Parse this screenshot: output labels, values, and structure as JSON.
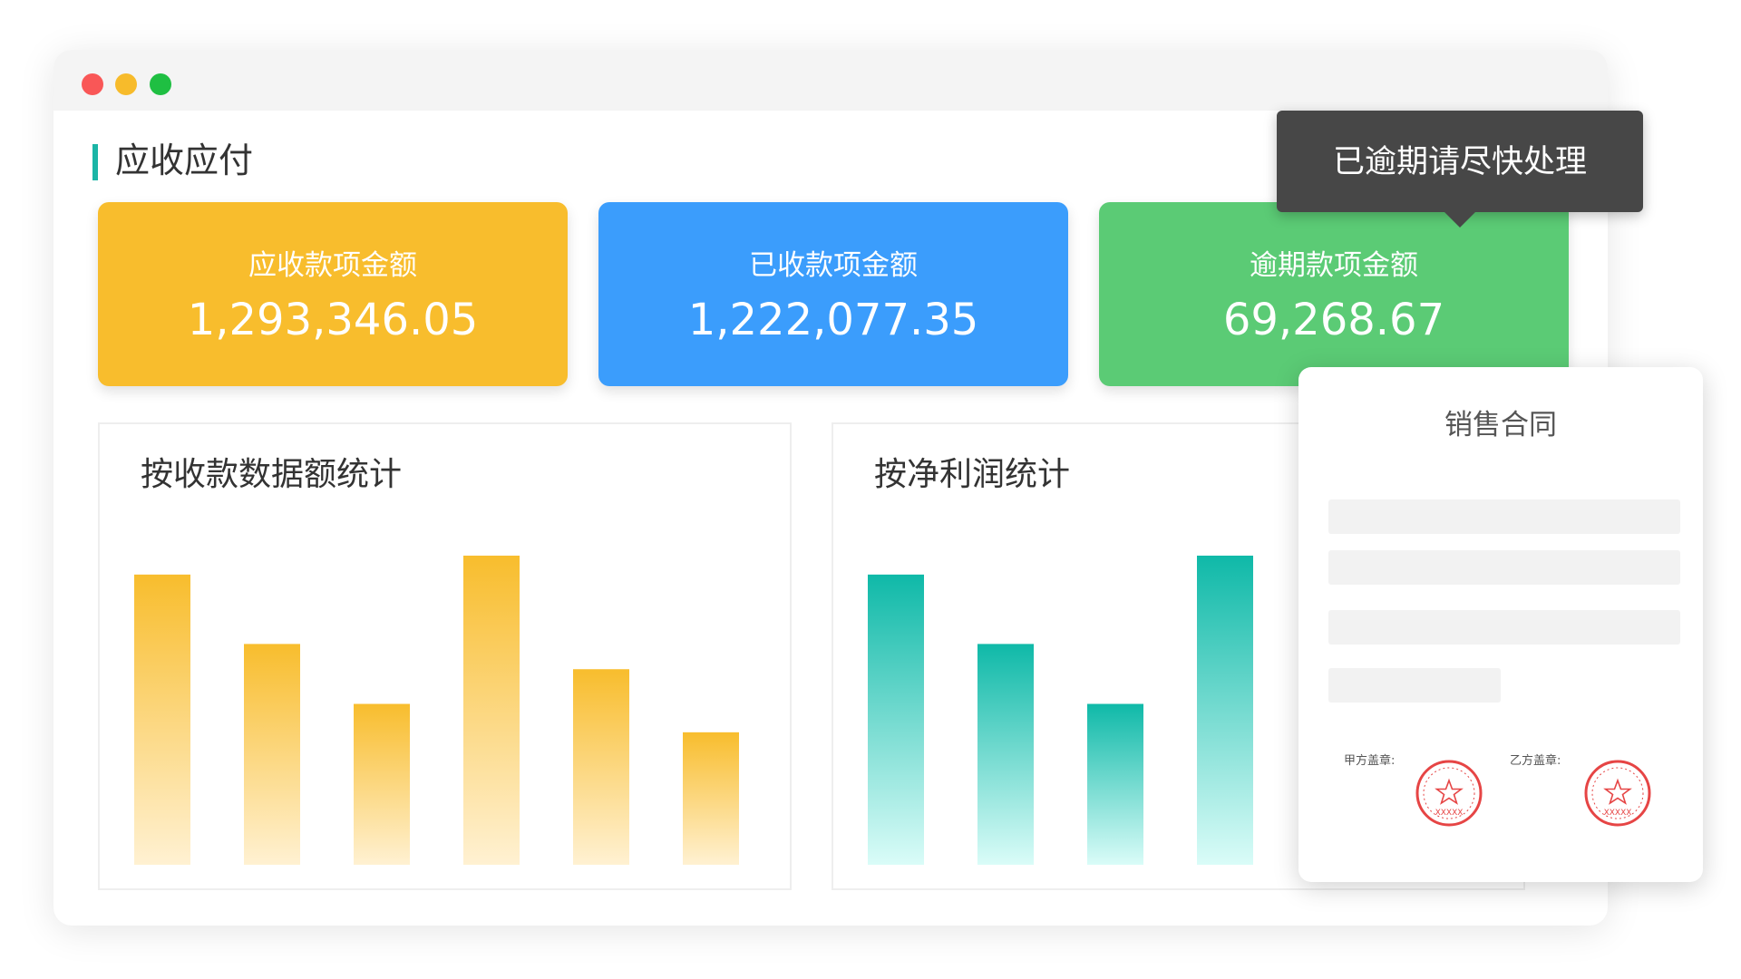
{
  "window": {
    "traffic_lights": [
      "close",
      "minimize",
      "maximize"
    ],
    "colors": {
      "close": "#f95757",
      "minimize": "#f7bb2b",
      "maximize": "#1fbf42"
    }
  },
  "section": {
    "title": "应收应付",
    "accent": "#1bb5a6"
  },
  "cards": [
    {
      "label": "应收款项金额",
      "value": "1,293,346.05",
      "color": "#f8bd2d"
    },
    {
      "label": "已收款项金额",
      "value": "1,222,077.35",
      "color": "#3b9dfc"
    },
    {
      "label": "逾期款项金额",
      "value": "69,268.67",
      "color": "#5bcb75"
    }
  ],
  "tooltip": {
    "text": "已逾期请尽快处理"
  },
  "chart_data": [
    {
      "type": "bar",
      "title": "按收款数据额统计",
      "categories": [],
      "values": [
        92,
        70,
        51,
        98,
        62,
        42
      ],
      "ylim": [
        0,
        100
      ],
      "grid": false,
      "colors": {
        "top": "#f8bd2d",
        "bottom": "#fff1d2"
      }
    },
    {
      "type": "bar",
      "title": "按净利润统计",
      "categories": [],
      "values": [
        92,
        70,
        51,
        98
      ],
      "ylim": [
        0,
        100
      ],
      "grid": false,
      "colors": {
        "top": "#0fb9a8",
        "bottom": "#dafcf8"
      }
    }
  ],
  "contract": {
    "title": "销售合同",
    "party_a_label": "甲方盖章:",
    "party_b_label": "乙方盖章:",
    "seal_text": "XXXXX",
    "seal_color": "#e64545"
  }
}
